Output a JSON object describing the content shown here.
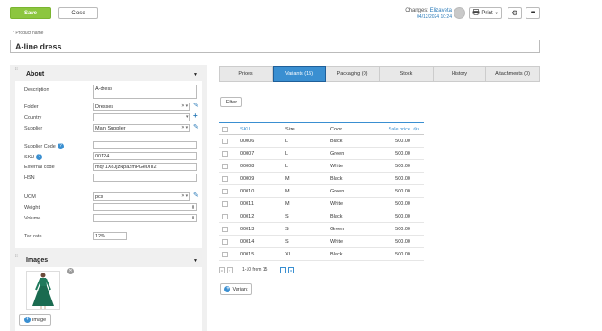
{
  "toolbar": {
    "save_label": "Save",
    "close_label": "Close",
    "changes_label": "Changes:",
    "changes_user": "Elizaveta",
    "changes_time": "04/12/2024 10:24",
    "print_label": "Print",
    "more_label": "•••"
  },
  "product_name": {
    "label": "* Product name",
    "value": "A-line dress"
  },
  "about": {
    "title": "About",
    "description": {
      "label": "Description",
      "value": "A-dress"
    },
    "folder": {
      "label": "Folder",
      "value": "Dresses"
    },
    "country": {
      "label": "Country",
      "value": ""
    },
    "supplier": {
      "label": "Supplier",
      "value": "Main Supplier"
    },
    "supplier_code": {
      "label": "Supplier Code",
      "value": ""
    },
    "sku": {
      "label": "SKU",
      "value": "00124"
    },
    "external_code": {
      "label": "External code",
      "value": "mq71XoJjzNpa2mPGeDIII2"
    },
    "hsn": {
      "label": "HSN",
      "value": ""
    },
    "uom": {
      "label": "UOM",
      "value": "pcs"
    },
    "weight": {
      "label": "Weight",
      "value": "0"
    },
    "volume": {
      "label": "Volume",
      "value": "0"
    },
    "tax_rate": {
      "label": "Tax rate",
      "value": "12%"
    }
  },
  "images": {
    "title": "Images",
    "add_label": "Image"
  },
  "tabs": [
    {
      "label": "Prices"
    },
    {
      "label": "Variants (15)"
    },
    {
      "label": "Packaging (0)"
    },
    {
      "label": "Stock"
    },
    {
      "label": "History"
    },
    {
      "label": "Attachments (0)"
    }
  ],
  "filter_label": "Filter",
  "table": {
    "headers": [
      "SKU",
      "Size",
      "Color",
      "Sale price"
    ],
    "rows": [
      [
        "00006",
        "L",
        "Black",
        "500.00"
      ],
      [
        "00007",
        "L",
        "Green",
        "500.00"
      ],
      [
        "00008",
        "L",
        "White",
        "500.00"
      ],
      [
        "00009",
        "M",
        "Black",
        "500.00"
      ],
      [
        "00010",
        "M",
        "Green",
        "500.00"
      ],
      [
        "00011",
        "M",
        "White",
        "500.00"
      ],
      [
        "00012",
        "S",
        "Black",
        "500.00"
      ],
      [
        "00013",
        "S",
        "Green",
        "500.00"
      ],
      [
        "00014",
        "S",
        "White",
        "500.00"
      ],
      [
        "00015",
        "XL",
        "Black",
        "500.00"
      ]
    ]
  },
  "pager": {
    "range_text": "1-10 from 15"
  },
  "variant_button_label": "Variant",
  "colors": {
    "accent": "#3a8fd1",
    "save_green": "#8cc63f"
  }
}
